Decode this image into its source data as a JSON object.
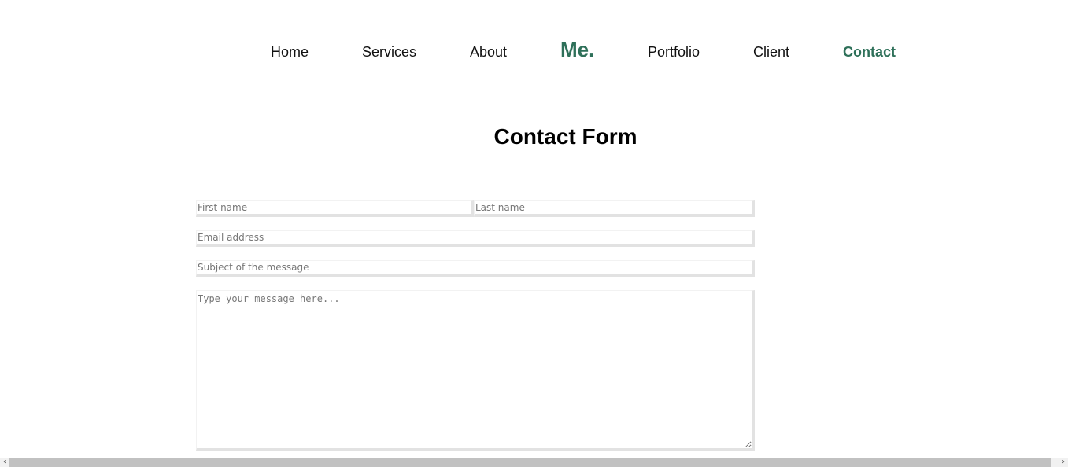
{
  "theme": {
    "accent": "#2e7059"
  },
  "nav": {
    "home": "Home",
    "services": "Services",
    "about": "About",
    "logo": "Me.",
    "portfolio": "Portfolio",
    "client": "Client",
    "contact": "Contact",
    "active": "Contact"
  },
  "form": {
    "title": "Contact Form",
    "first_name": {
      "value": "",
      "placeholder": "First name"
    },
    "last_name": {
      "value": "",
      "placeholder": "Last name"
    },
    "email": {
      "value": "",
      "placeholder": "Email address"
    },
    "subject": {
      "value": "",
      "placeholder": "Subject of the message"
    },
    "message": {
      "value": "",
      "placeholder": "Type your message here..."
    }
  },
  "scrollbar": {
    "left_arrow": "‹",
    "right_arrow": "›"
  }
}
